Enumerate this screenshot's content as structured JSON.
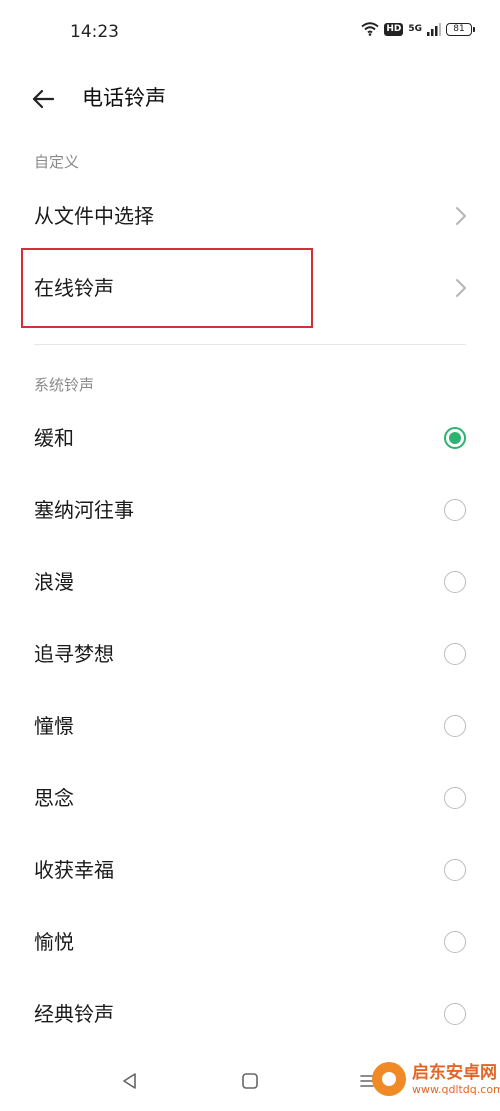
{
  "status_bar": {
    "time": "14:23",
    "network": "5G",
    "hd": "HD",
    "battery": "81"
  },
  "header": {
    "title": "电话铃声"
  },
  "sections": {
    "custom_label": "自定义",
    "system_label": "系统铃声"
  },
  "custom_items": [
    {
      "label": "从文件中选择"
    },
    {
      "label": "在线铃声"
    }
  ],
  "ringtones": [
    {
      "label": "缓和",
      "selected": true
    },
    {
      "label": "塞纳河往事",
      "selected": false
    },
    {
      "label": "浪漫",
      "selected": false
    },
    {
      "label": "追寻梦想",
      "selected": false
    },
    {
      "label": "憧憬",
      "selected": false
    },
    {
      "label": "思念",
      "selected": false
    },
    {
      "label": "收获幸福",
      "selected": false
    },
    {
      "label": "愉悦",
      "selected": false
    },
    {
      "label": "经典铃声",
      "selected": false
    }
  ],
  "watermark": {
    "name": "启东安卓网",
    "url": "www.qdltdq.com"
  },
  "colors": {
    "accent": "#2db36f",
    "highlight": "#d32f3a"
  }
}
